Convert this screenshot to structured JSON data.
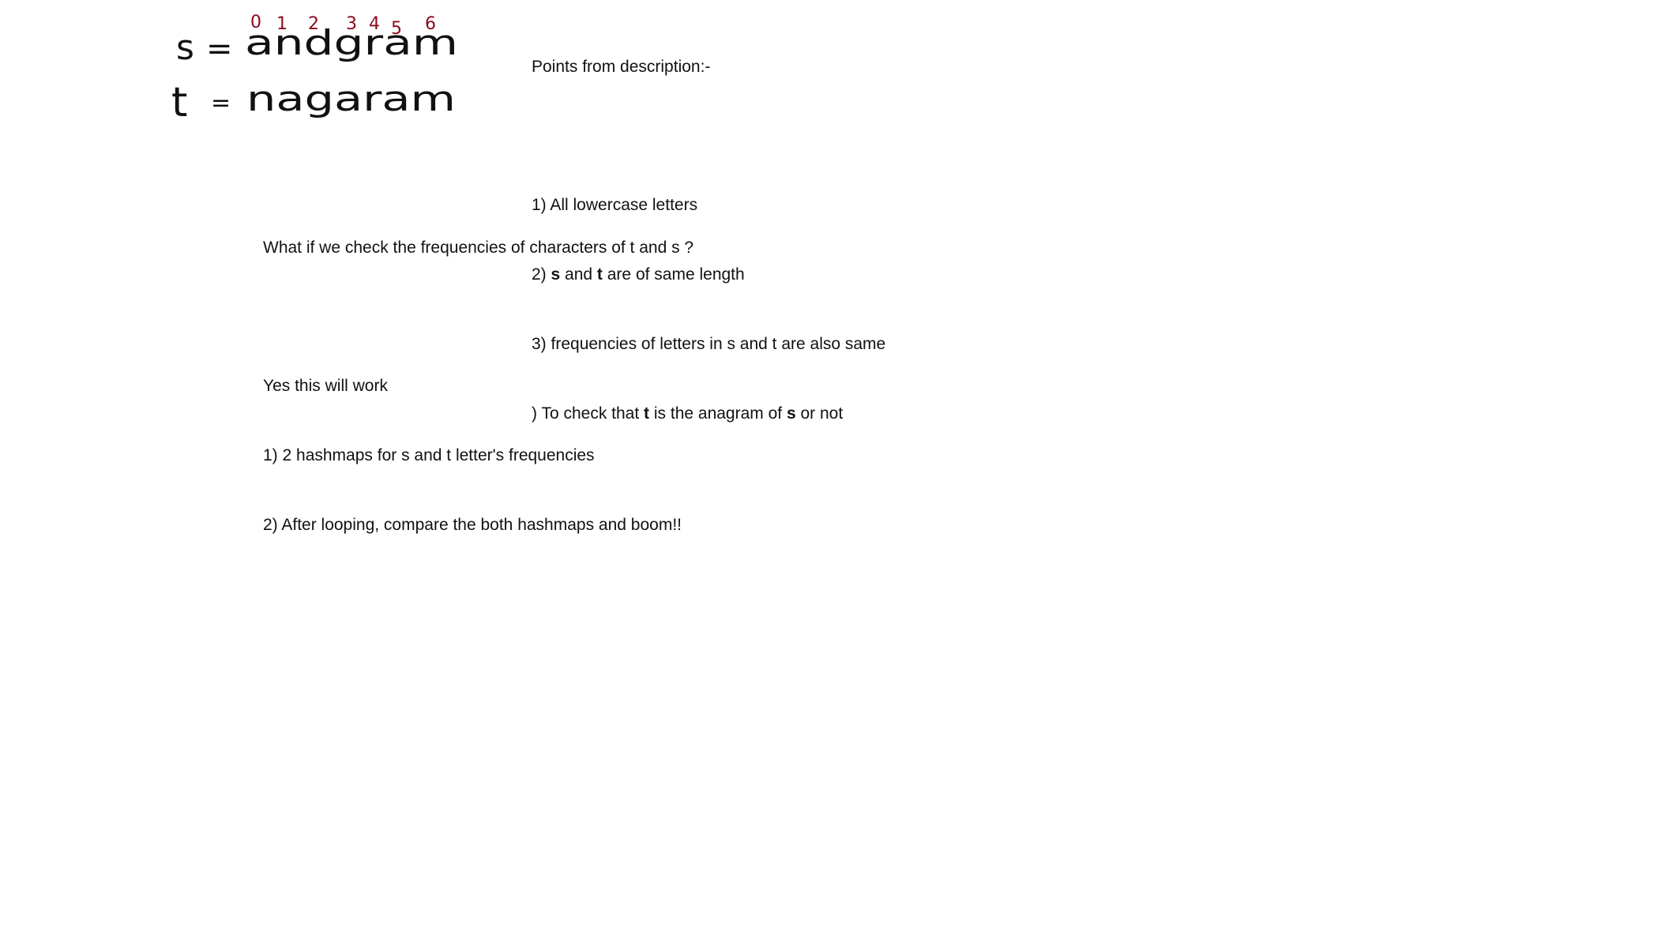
{
  "handwritten": {
    "indices": [
      "0",
      "1",
      "2",
      "3",
      "4",
      "5",
      "6"
    ],
    "s_label": "s",
    "t_label": "t",
    "equals": "=",
    "s_value": "andgram",
    "t_value": "nagaram"
  },
  "points": {
    "heading": "Points from description:-",
    "item1": "1) All lowercase letters",
    "item2_prefix": "2) ",
    "item2_s": "s",
    "item2_mid": " and ",
    "item2_t": "t",
    "item2_suffix": " are of same length",
    "item3": "3) frequencies of letters in s and t are also same",
    "item4_prefix": ") To check that ",
    "item4_t": "t",
    "item4_mid": " is the anagram of ",
    "item4_s": "s",
    "item4_suffix": " or not"
  },
  "analysis": {
    "question": "What if we check the frequencies of characters of t and s ?",
    "answer": "Yes this will work",
    "step1": "1) 2 hashmaps for s and t letter's frequencies",
    "step2": "2) After looping, compare the both hashmaps and boom!!"
  },
  "colors": {
    "ink": "#111111",
    "index_ink": "#8b0a1e",
    "background": "#ffffff"
  }
}
